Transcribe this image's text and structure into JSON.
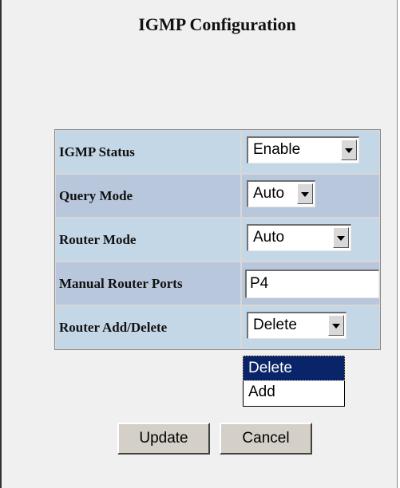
{
  "page": {
    "title": "IGMP Configuration"
  },
  "form": {
    "igmp_status": {
      "label": "IGMP Status",
      "value": "Enable"
    },
    "query_mode": {
      "label": "Query Mode",
      "value": "Auto"
    },
    "router_mode": {
      "label": "Router Mode",
      "value": "Auto"
    },
    "manual_router_ports": {
      "label": "Manual Router Ports",
      "value": "P4"
    },
    "router_add_delete": {
      "label": "Router Add/Delete",
      "value": "Delete",
      "open_options": [
        "Delete",
        "Add"
      ],
      "highlighted_option": "Delete"
    }
  },
  "buttons": {
    "update": "Update",
    "cancel": "Cancel"
  },
  "colors": {
    "row_light": "#c4d7e6",
    "row_alt": "#b9c7dd",
    "selection": "#0a246a",
    "background": "#f0f0f0"
  }
}
